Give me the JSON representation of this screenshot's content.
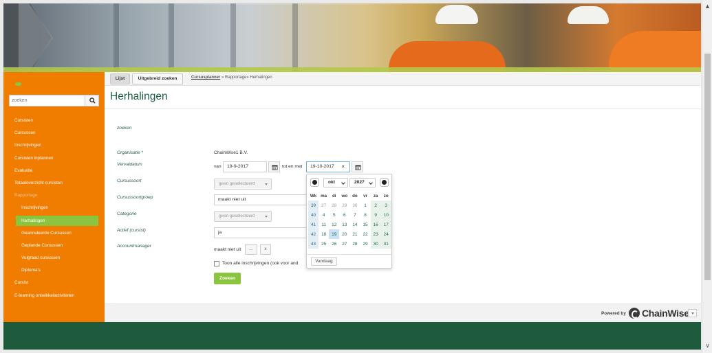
{
  "search": {
    "placeholder": "zoeken"
  },
  "sidebar": {
    "items": [
      {
        "label": "Cursisten"
      },
      {
        "label": "Cursussen"
      },
      {
        "label": "Inschrijvingen"
      },
      {
        "label": "Cursisten inplannen"
      },
      {
        "label": "Evaluatie"
      },
      {
        "label": "Totaaloverzicht cursisten"
      },
      {
        "label": "Rapportage"
      },
      {
        "label": "Inschrijvingen"
      },
      {
        "label": "Herhalingen"
      },
      {
        "label": "Geannuleerde Cursussen"
      },
      {
        "label": "Geplande Cursussen"
      },
      {
        "label": "Vulgraad cursussen"
      },
      {
        "label": "Diploma's"
      },
      {
        "label": "Cursist"
      },
      {
        "label": "E-learning ontwikkelactiviteiten"
      }
    ]
  },
  "toolbar": {
    "tab_list": "Lijst",
    "tab_advanced": "Uitgebreid zoeken"
  },
  "breadcrumb": {
    "link": "Cursusplanner",
    "rest": " » Rapportage» Herhalingen"
  },
  "page": {
    "title": "Herhalingen",
    "section": "zoeken"
  },
  "form": {
    "organisatie_label": "Organisatie *",
    "organisatie_value": "ChainWise1 B.V.",
    "vervaldatum_label": "Vervaldatum",
    "van_label": "van",
    "van_value": "19-9-2017",
    "tot_label": "tot en met",
    "tot_value": "19-10-2017",
    "clear_glyph": "×",
    "cursussoort_label": "Cursussoort",
    "cursussoort_value": "geen geselecteerd",
    "cursussoortgroep_label": "Cursussoortgroep",
    "cursussoortgroep_value": "maakt niet uit",
    "categorie_label": "Categorie",
    "categorie_value": "geen geselecteerd",
    "actief_label": "Actief (cursist)",
    "actief_value": "ja",
    "accountmanager_label": "Accountmanager",
    "accountmanager_value": "maakt niet uit",
    "ellipsis_label": "...",
    "clear_label": "x",
    "checkbox_label": "Toon alle inschrijvingen (ook voor and",
    "submit_label": "Zoeken"
  },
  "datepicker": {
    "month": "okt",
    "year": "2027",
    "headers": [
      "Wk",
      "ma",
      "di",
      "wo",
      "do",
      "vr",
      "za",
      "zo"
    ],
    "rows": [
      [
        "39",
        "27",
        "28",
        "29",
        "30",
        "1",
        "2",
        "3"
      ],
      [
        "40",
        "4",
        "5",
        "6",
        "7",
        "8",
        "9",
        "10"
      ],
      [
        "41",
        "11",
        "12",
        "13",
        "14",
        "15",
        "16",
        "17"
      ],
      [
        "42",
        "18",
        "19",
        "20",
        "21",
        "22",
        "23",
        "24"
      ],
      [
        "43",
        "25",
        "26",
        "27",
        "28",
        "29",
        "30",
        "31"
      ]
    ],
    "today_label": "Vandaag"
  },
  "footer": {
    "powered": "Powered by",
    "brand": "ChainWise"
  }
}
